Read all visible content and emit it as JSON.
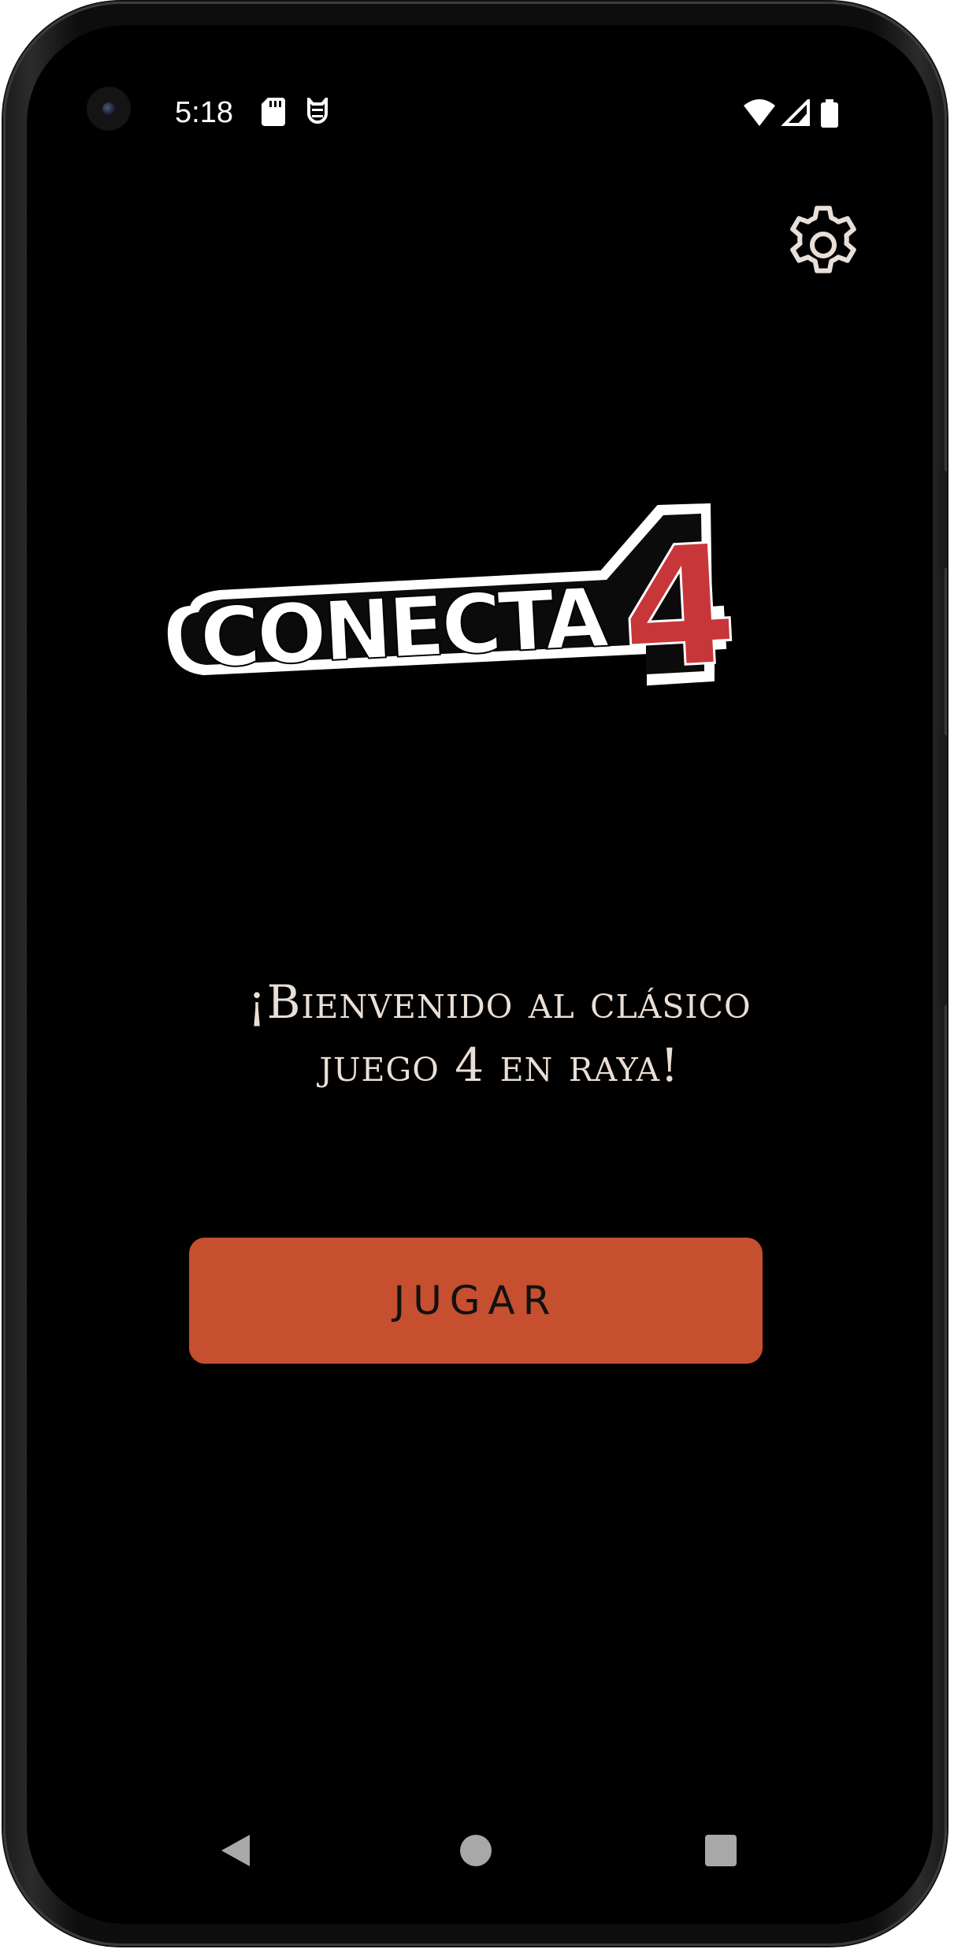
{
  "status_bar": {
    "time": "5:18",
    "icons": [
      "sd-card-icon",
      "android-debug-icon",
      "wifi-icon",
      "cell-signal-icon",
      "battery-icon"
    ]
  },
  "header": {
    "settings_icon": "gear-icon"
  },
  "logo": {
    "text": "CONECTA",
    "number": "4",
    "colors": {
      "text_fill": "#ffffff",
      "outline": "#000000",
      "number_fill": "#c7373a"
    }
  },
  "welcome": {
    "line1": "¡Bienvenido al clásico",
    "line2": "juego 4 en raya!"
  },
  "play_button": {
    "label": "JUGAR"
  },
  "colors": {
    "background": "#000000",
    "accent": "#c54f2e",
    "text": "#eadfd6",
    "icon": "#eadfd6"
  },
  "nav_bar": {
    "icons": [
      "back-icon",
      "home-icon",
      "recents-icon"
    ]
  }
}
